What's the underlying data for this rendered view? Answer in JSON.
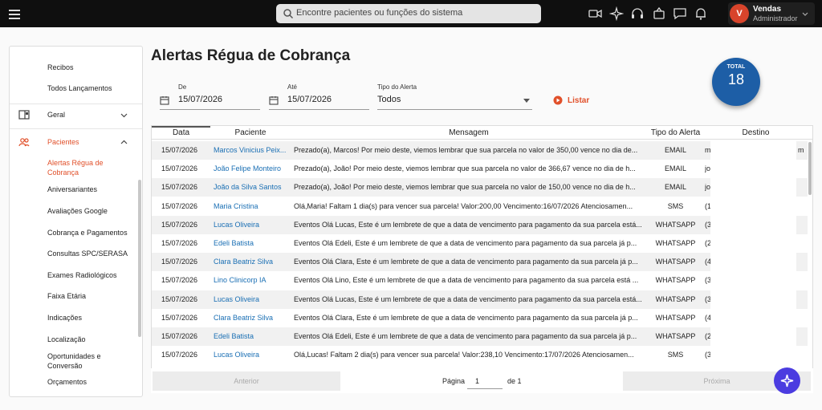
{
  "topbar": {
    "search_placeholder": "Encontre pacientes ou funções do sistema",
    "user_name": "Vendas",
    "user_role": "Administrador",
    "avatar_initial": "V"
  },
  "sidebar": {
    "financeiro_items": [
      "Recibos",
      "Todos Lançamentos"
    ],
    "geral_label": "Geral",
    "pacientes_label": "Pacientes",
    "pacientes_items": [
      "Alertas Régua de Cobrança",
      "Aniversariantes",
      "Avaliações Google",
      "Cobrança e Pagamentos",
      "Consultas SPC/SERASA",
      "Exames Radiológicos",
      "Faixa Etária",
      "Indicações",
      "Localização",
      "Oportunidades e Conversão",
      "Orçamentos"
    ],
    "active_color": "#e1502a"
  },
  "page": {
    "title": "Alertas Régua de Cobrança",
    "filters": {
      "de_label": "De",
      "de_value": "15/07/2026",
      "ate_label": "Até",
      "ate_value": "15/07/2026",
      "tipo_label": "Tipo do Alerta",
      "tipo_value": "Todos",
      "listar_label": "Listar"
    },
    "total": {
      "label": "TOTAL",
      "value": "18",
      "color": "#1d5ea6"
    }
  },
  "table": {
    "columns": [
      "Data",
      "Paciente",
      "Mensagem",
      "Tipo do Alerta",
      "Destino"
    ],
    "rows": [
      {
        "data": "15/07/2026",
        "paciente": "Marcos Vinicius Peix...",
        "mensagem": "Prezado(a), Marcos! Por meio deste, viemos lembrar que sua parcela no valor de 350,00 vence no dia de...",
        "tipo": "EMAIL",
        "destino": "m",
        "destino_end": "m"
      },
      {
        "data": "15/07/2026",
        "paciente": "João Felipe Monteiro",
        "mensagem": "Prezado(a), João! Por meio deste, viemos lembrar que sua parcela no valor de 366,67 vence no dia de h...",
        "tipo": "EMAIL",
        "destino": "jo",
        "destino_end": ""
      },
      {
        "data": "15/07/2026",
        "paciente": "João da Silva Santos",
        "mensagem": "Prezado(a), João! Por meio deste, viemos lembrar que sua parcela no valor de 150,00 vence no dia de h...",
        "tipo": "EMAIL",
        "destino": "jo",
        "destino_end": ""
      },
      {
        "data": "15/07/2026",
        "paciente": "Maria Cristina",
        "mensagem": "Olá,Maria! Faltam 1 dia(s) para vencer sua parcela! Valor:200,00 Vencimento:16/07/2026 Atenciosamen...",
        "tipo": "SMS",
        "destino": "(1",
        "destino_end": ""
      },
      {
        "data": "15/07/2026",
        "paciente": "Lucas Oliveira",
        "mensagem": "Eventos Olá Lucas, Este é um lembrete de que a data de vencimento para pagamento da sua parcela está...",
        "tipo": "WHATSAPP",
        "destino": "(3",
        "destino_end": ""
      },
      {
        "data": "15/07/2026",
        "paciente": "Edeli Batista",
        "mensagem": "Eventos Olá Edeli, Este é um lembrete de que a data de vencimento para pagamento da sua parcela já p...",
        "tipo": "WHATSAPP",
        "destino": "(2",
        "destino_end": ""
      },
      {
        "data": "15/07/2026",
        "paciente": "Clara Beatriz Silva",
        "mensagem": "Eventos Olá Clara, Este é um lembrete de que a data de vencimento para pagamento da sua parcela já p...",
        "tipo": "WHATSAPP",
        "destino": "(4",
        "destino_end": ""
      },
      {
        "data": "15/07/2026",
        "paciente": "Lino Clinicorp IA",
        "mensagem": "Eventos Olá Lino, Este é um lembrete de que a data de vencimento para pagamento da sua parcela está ...",
        "tipo": "WHATSAPP",
        "destino": "(3",
        "destino_end": ""
      },
      {
        "data": "15/07/2026",
        "paciente": "Lucas Oliveira",
        "mensagem": "Eventos Olá Lucas, Este é um lembrete de que a data de vencimento para pagamento da sua parcela está...",
        "tipo": "WHATSAPP",
        "destino": "(3",
        "destino_end": ""
      },
      {
        "data": "15/07/2026",
        "paciente": "Clara Beatriz Silva",
        "mensagem": "Eventos Olá Clara, Este é um lembrete de que a data de vencimento para pagamento da sua parcela já p...",
        "tipo": "WHATSAPP",
        "destino": "(4",
        "destino_end": ""
      },
      {
        "data": "15/07/2026",
        "paciente": "Edeli Batista",
        "mensagem": "Eventos Olá Edeli, Este é um lembrete de que a data de vencimento para pagamento da sua parcela já p...",
        "tipo": "WHATSAPP",
        "destino": "(2",
        "destino_end": ""
      },
      {
        "data": "15/07/2026",
        "paciente": "Lucas Oliveira",
        "mensagem": "Olá,Lucas! Faltam 2 dia(s) para vencer sua parcela! Valor:238,10 Vencimento:17/07/2026 Atenciosamen...",
        "tipo": "SMS",
        "destino": "(3",
        "destino_end": ""
      }
    ],
    "link_color": "#1a6fb4"
  },
  "pagination": {
    "prev_label": "Anterior",
    "page_label": "Página",
    "page_value": "1",
    "of_label": "de 1",
    "next_label": "Próxima"
  }
}
